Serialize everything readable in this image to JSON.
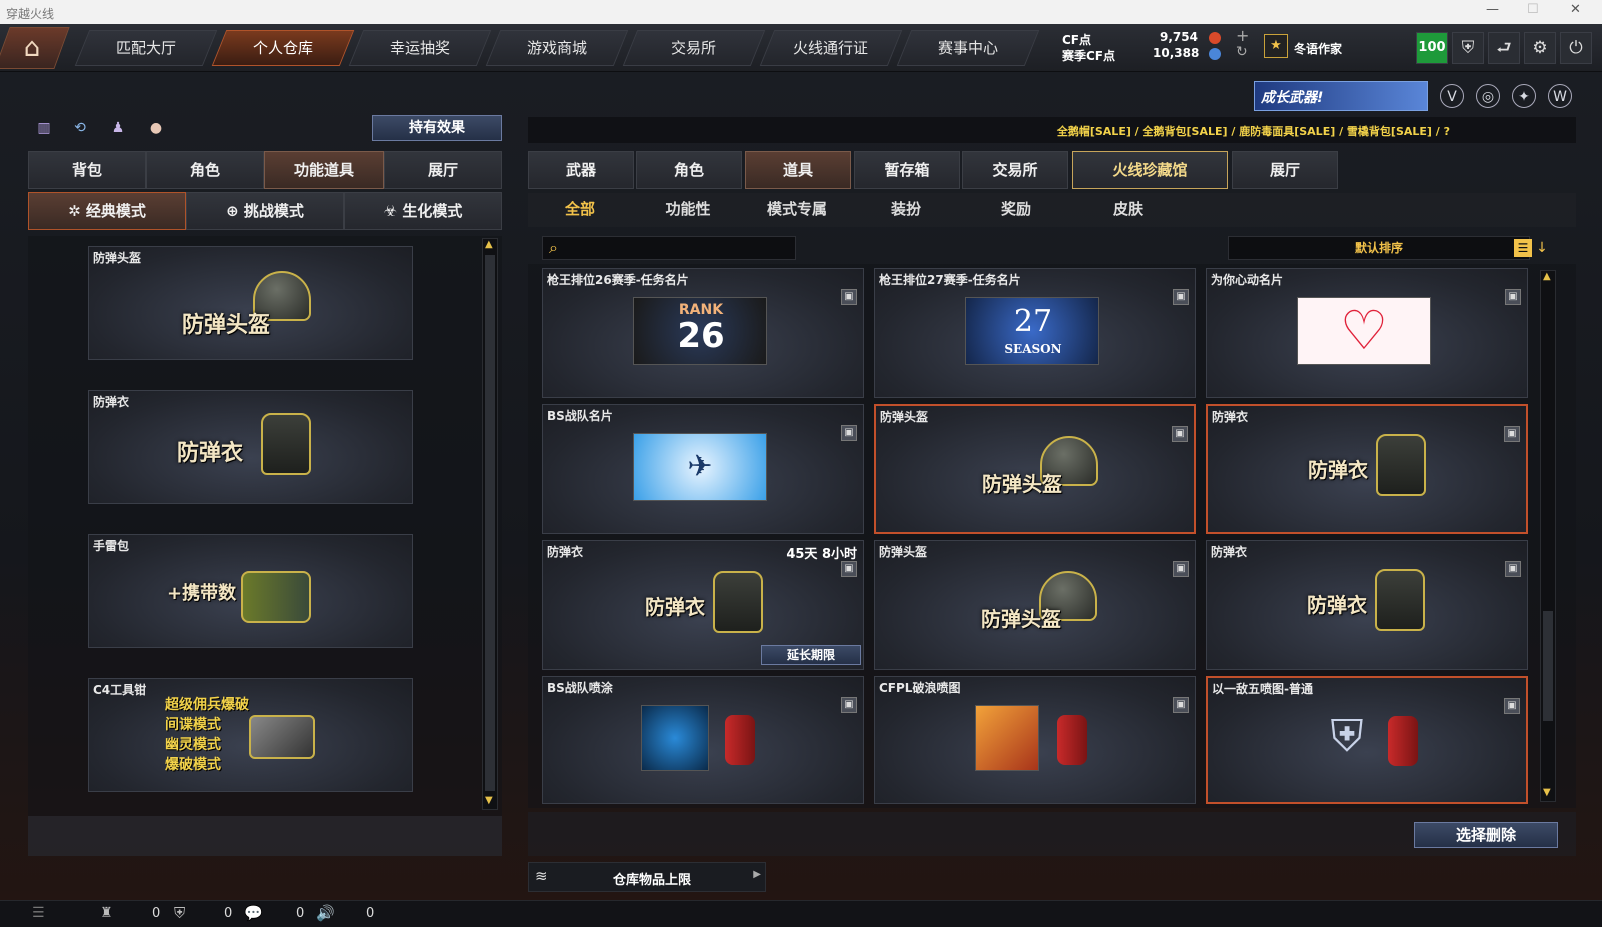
{
  "window": {
    "title": "穿越火线"
  },
  "nav": {
    "tabs": [
      "匹配大厅",
      "个人仓库",
      "幸运抽奖",
      "游戏商城",
      "交易所",
      "火线通行证",
      "赛事中心"
    ]
  },
  "currency": {
    "cf_label": "CF点",
    "cf_value": "9,754",
    "season_label": "赛季CF点",
    "season_value": "10,388"
  },
  "user": {
    "name": "冬语作家",
    "level": "100"
  },
  "left": {
    "effects_button": "持有效果",
    "tabs": [
      "背包",
      "角色",
      "功能道具",
      "展厅"
    ],
    "modes": [
      "经典模式",
      "挑战模式",
      "生化模式"
    ],
    "items": [
      {
        "label": "防弹头盔",
        "big": "防弹头盔"
      },
      {
        "label": "防弹衣",
        "big": "防弹衣"
      },
      {
        "label": "手雷包",
        "big": "+携带数"
      },
      {
        "label": "C4工具钳",
        "lines": [
          "超级佣兵爆破",
          "间谍模式",
          "幽灵模式",
          "爆破模式"
        ]
      }
    ]
  },
  "right": {
    "ticker": "全鹅帽[SALE] / 全鹅背包[SALE] / 鹿防毒面具[SALE] / 雪橇背包[SALE] / ?",
    "banner": "成长武器!",
    "tabs": [
      "武器",
      "角色",
      "道具",
      "暂存箱",
      "交易所",
      "火线珍藏馆",
      "展厅"
    ],
    "subtabs": [
      "全部",
      "功能性",
      "模式专属",
      "装扮",
      "奖励",
      "皮肤"
    ],
    "sort": "默认排序",
    "items": [
      {
        "label": "枪王排位26赛季-任务名片",
        "kind": "rank",
        "rank_text": "RANK",
        "rank_num": "26"
      },
      {
        "label": "枪王排位27赛季-任务名片",
        "kind": "season",
        "season_num": "27",
        "season_text": "SEASON"
      },
      {
        "label": "为你心动名片",
        "kind": "heart"
      },
      {
        "label": "BS战队名片",
        "kind": "bs"
      },
      {
        "label": "防弹头盔",
        "kind": "helmet",
        "big": "防弹头盔",
        "selected": true
      },
      {
        "label": "防弹衣",
        "kind": "vest",
        "big": "防弹衣",
        "selected": true
      },
      {
        "label": "防弹衣",
        "kind": "vest",
        "big": "防弹衣",
        "timer": "45天 8小时",
        "extend": "延长期限"
      },
      {
        "label": "防弹头盔",
        "kind": "helmet",
        "big": "防弹头盔"
      },
      {
        "label": "防弹衣",
        "kind": "vest",
        "big": "防弹衣"
      },
      {
        "label": "BS战队喷涂",
        "kind": "spray"
      },
      {
        "label": "CFPL破浪喷图",
        "kind": "spray2"
      },
      {
        "label": "以一敌五喷图-普通",
        "kind": "spray3",
        "selected": true
      }
    ],
    "delete_button": "选择删除",
    "capacity": "仓库物品上限"
  },
  "status": {
    "counts": [
      "0",
      "0",
      "0",
      "0"
    ]
  },
  "colors": {
    "accent": "#c2502b",
    "gold": "#f2c24a",
    "level": "#1e9a3a"
  }
}
